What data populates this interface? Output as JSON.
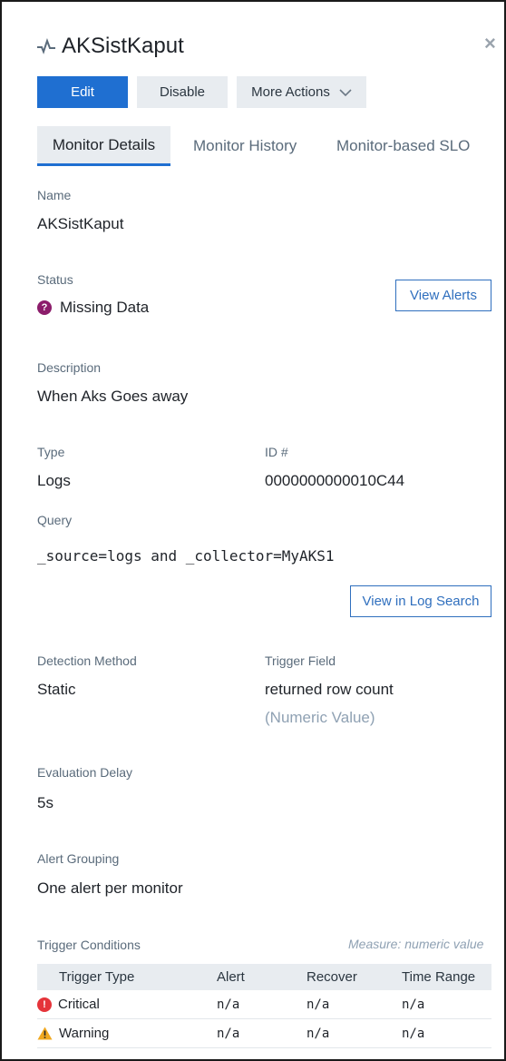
{
  "header": {
    "title": "AKSistKaput",
    "close_glyph": "×"
  },
  "actions": {
    "edit": "Edit",
    "disable": "Disable",
    "more": "More Actions"
  },
  "tabs": [
    {
      "label": "Monitor Details",
      "active": true
    },
    {
      "label": "Monitor History",
      "active": false
    },
    {
      "label": "Monitor-based SLO",
      "active": false
    }
  ],
  "details": {
    "name_label": "Name",
    "name": "AKSistKaput",
    "status_label": "Status",
    "status": "Missing Data",
    "status_icon": "question-icon",
    "view_alerts": "View Alerts",
    "description_label": "Description",
    "description": "When Aks Goes away",
    "type_label": "Type",
    "type": "Logs",
    "id_label": "ID #",
    "id": "0000000000010C44",
    "query_label": "Query",
    "query": "_source=logs and _collector=MyAKS1",
    "view_log_search": "View in Log Search",
    "detection_label": "Detection Method",
    "detection": "Static",
    "trigger_field_label": "Trigger Field",
    "trigger_field": "returned row count",
    "trigger_field_note": "(Numeric Value)",
    "eval_delay_label": "Evaluation Delay",
    "eval_delay": "5s",
    "alert_grouping_label": "Alert Grouping",
    "alert_grouping": "One alert per monitor"
  },
  "trigger_conditions": {
    "label": "Trigger Conditions",
    "measure": "Measure: numeric value",
    "headers": [
      "Trigger Type",
      "Alert",
      "Recover",
      "Time Range"
    ],
    "rows": [
      {
        "type": "Critical",
        "icon": "critical-icon",
        "alert": "n/a",
        "recover": "n/a",
        "time_range": "n/a"
      },
      {
        "type": "Warning",
        "icon": "warning-icon",
        "alert": "n/a",
        "recover": "n/a",
        "time_range": "n/a"
      }
    ]
  },
  "colors": {
    "primary": "#1f6fd1",
    "missing_data": "#8c1d6b",
    "critical": "#e5343a",
    "warning": "#f0a820"
  }
}
